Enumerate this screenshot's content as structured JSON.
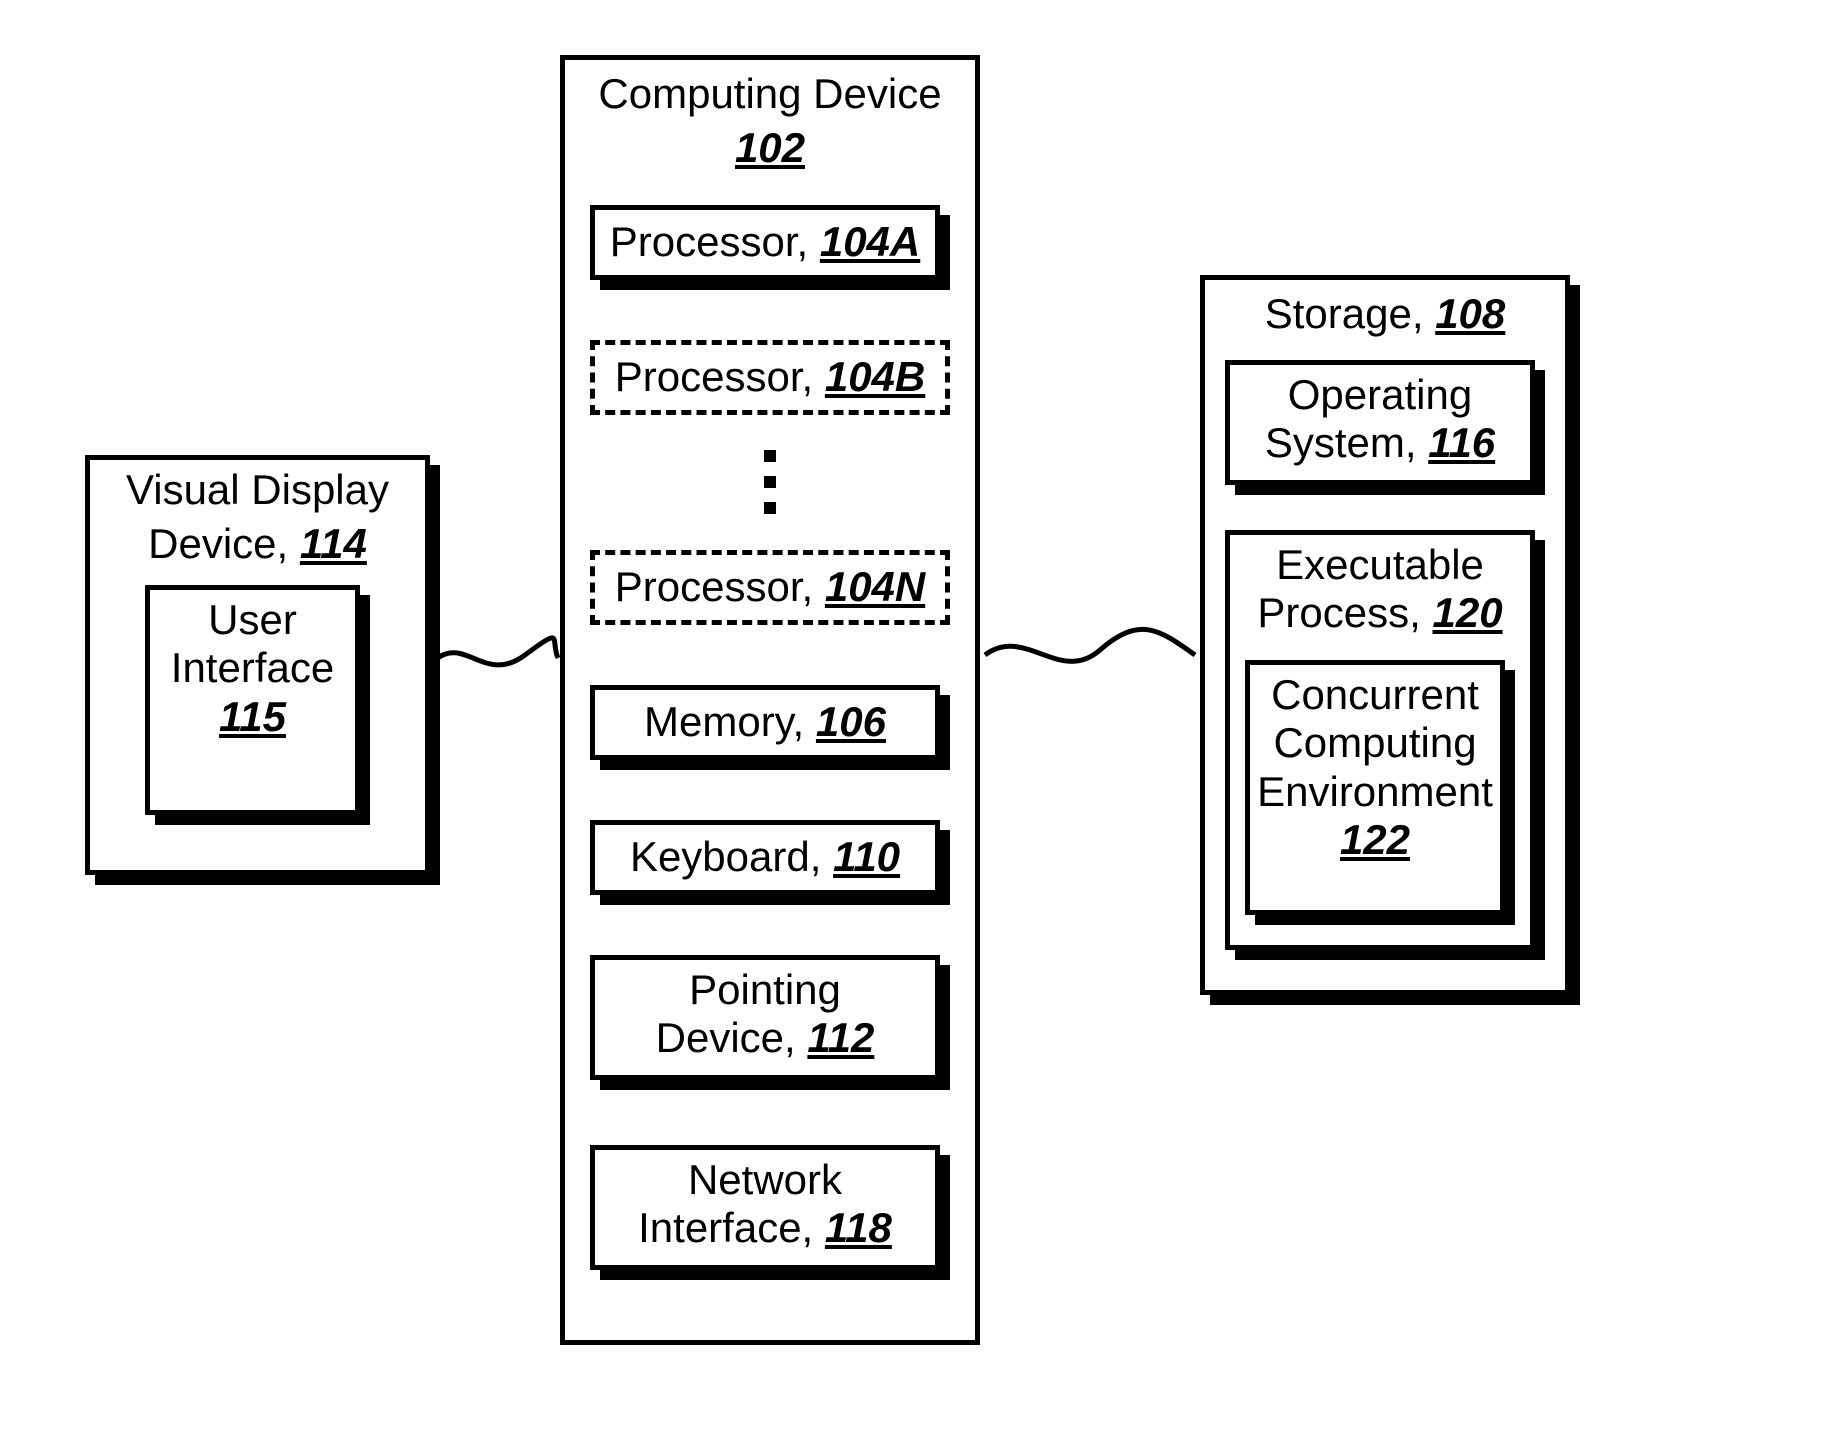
{
  "visual_display": {
    "title_line1": "Visual Display",
    "title_line2_text": "Device, ",
    "title_line2_ref": "114",
    "ui_line1": "User",
    "ui_line2": "Interface",
    "ui_ref": "115"
  },
  "computing_device": {
    "title_line1": "Computing Device",
    "title_ref": "102",
    "proc_a_text": "Processor, ",
    "proc_a_ref": "104A",
    "proc_b_text": "Processor, ",
    "proc_b_ref": "104B",
    "proc_n_text": "Processor, ",
    "proc_n_ref": "104N",
    "memory_text": "Memory, ",
    "memory_ref": "106",
    "keyboard_text": "Keyboard, ",
    "keyboard_ref": "110",
    "pointing_line1": "Pointing",
    "pointing_line2_text": "Device, ",
    "pointing_line2_ref": "112",
    "network_line1": "Network",
    "network_line2_text": "Interface, ",
    "network_line2_ref": "118"
  },
  "storage": {
    "title_text": "Storage, ",
    "title_ref": "108",
    "os_line1": "Operating",
    "os_line2_text": "System, ",
    "os_line2_ref": "116",
    "exec_line1": "Executable",
    "exec_line2_text": "Process, ",
    "exec_line2_ref": "120",
    "cce_line1": "Concurrent",
    "cce_line2": "Computing",
    "cce_line3": "Environment",
    "cce_ref": "122"
  }
}
